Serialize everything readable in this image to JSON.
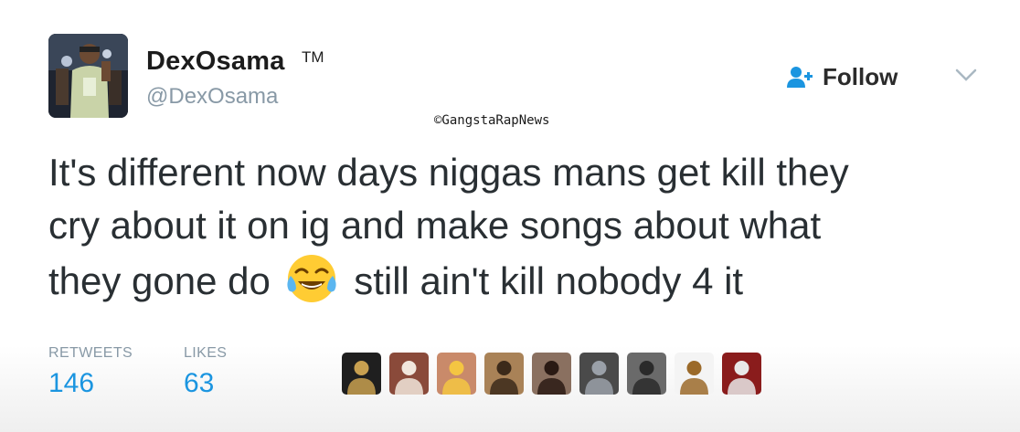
{
  "tweet": {
    "display_name": "DexOsama",
    "trademark": "TM",
    "handle": "@DexOsama",
    "follow_label": "Follow",
    "watermark": "©GangstaRapNews",
    "text_lines": [
      "It's different now days niggas mans get kill they",
      "cry about it on ig and make songs about what",
      "they gone do",
      "still ain't kill nobody 4 it"
    ],
    "emoji": "face-with-tears-of-joy"
  },
  "stats": {
    "retweets_label": "RETWEETS",
    "retweets_value": "146",
    "likes_label": "LIKES",
    "likes_value": "63"
  },
  "likers": [
    {
      "name": "liker-avatar-1",
      "bg": "#1f1f1f",
      "fg": "#c8a050"
    },
    {
      "name": "liker-avatar-2",
      "bg": "#8a4a3a",
      "fg": "#f1e6dc"
    },
    {
      "name": "liker-avatar-3",
      "bg": "#c98a6a",
      "fg": "#f4c542"
    },
    {
      "name": "liker-avatar-4",
      "bg": "#a98257",
      "fg": "#3c2a1a"
    },
    {
      "name": "liker-avatar-5",
      "bg": "#8a7060",
      "fg": "#2a1a14"
    },
    {
      "name": "liker-avatar-6",
      "bg": "#4a4a4a",
      "fg": "#9aa0a8"
    },
    {
      "name": "liker-avatar-7",
      "bg": "#6a6a6a",
      "fg": "#2a2a2a"
    },
    {
      "name": "liker-avatar-8",
      "bg": "#f4f4f4",
      "fg": "#9b6a2a"
    },
    {
      "name": "liker-avatar-9",
      "bg": "#8a1c1c",
      "fg": "#e8e8e8"
    }
  ],
  "colors": {
    "accent": "#1b95e0",
    "muted": "#8899a6",
    "text": "#292f33"
  }
}
